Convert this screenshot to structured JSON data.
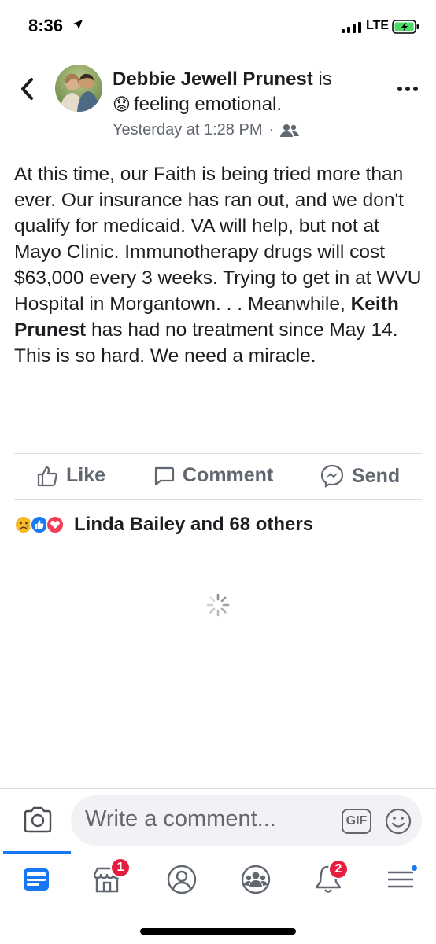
{
  "status_bar": {
    "time": "8:36",
    "network": "LTE"
  },
  "post": {
    "author": "Debbie Jewell Prunest",
    "author_suffix": " is",
    "feeling_emoji": "😟",
    "feeling_text": "feeling emotional.",
    "timestamp": "Yesterday at 1:28 PM",
    "separator": "·",
    "audience_icon": "friends-icon",
    "body_part1": "At this time, our Faith is being tried more than ever. Our insurance has ran out, and we don't qualify for medicaid. VA will help, but not at Mayo Clinic. Immunotherapy drugs will cost $63,000 every 3 weeks.  Trying to get in at WVU Hospital in Morgantown. . . Meanwhile, ",
    "mention": "Keith Prunest",
    "body_part2": " has had no treatment since May 14.  This is so hard.  We need a miracle."
  },
  "actions": {
    "like": "Like",
    "comment": "Comment",
    "send": "Send"
  },
  "reactions": {
    "summary": "Linda Bailey and 68 others",
    "icons": [
      "sad-icon",
      "like-icon",
      "love-icon"
    ]
  },
  "comment_bar": {
    "placeholder": "Write a comment...",
    "gif_label": "GIF"
  },
  "tab_bar": {
    "marketplace_badge": "1",
    "notifications_badge": "2"
  },
  "colors": {
    "accent": "#1877f2",
    "badge": "#e41e3f",
    "muted": "#606770",
    "battery": "#4cd964"
  }
}
